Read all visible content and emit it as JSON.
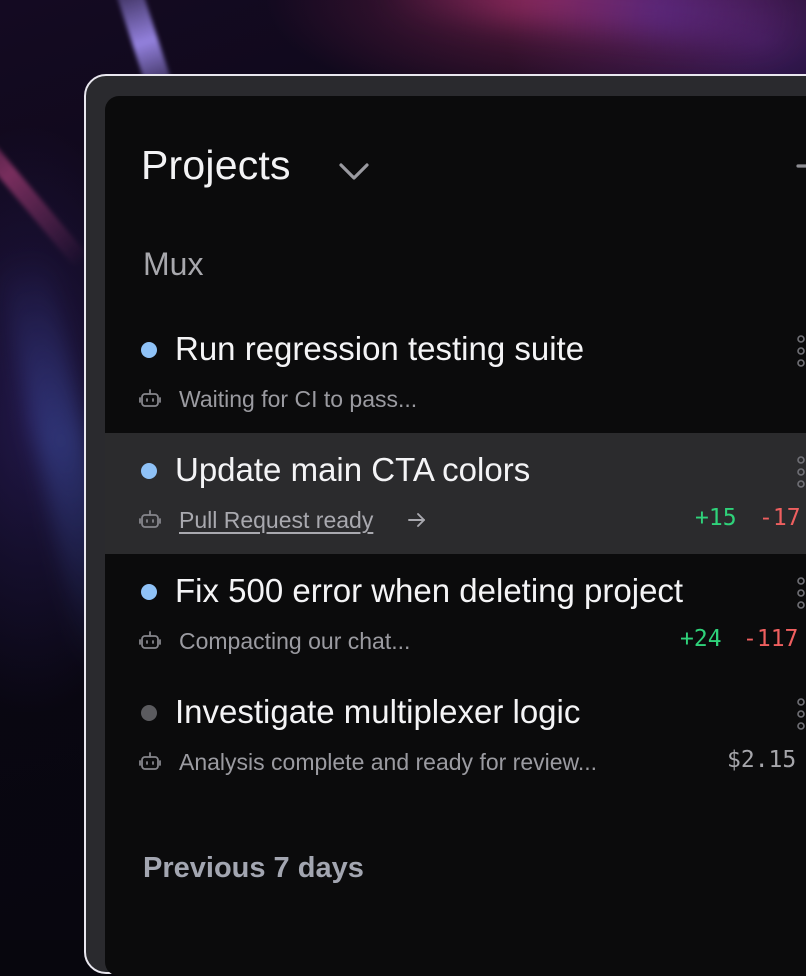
{
  "header": {
    "title": "Projects",
    "dropdown_icon": "chevron-down-icon",
    "add_icon": "plus-icon"
  },
  "group": {
    "name": "Mux"
  },
  "tasks": [
    {
      "title": "Run regression testing suite",
      "status": "Waiting for CI to pass...",
      "dot_color": "#8fc2f7",
      "active": true
    },
    {
      "title": "Update main CTA colors",
      "status": "Pull Request ready",
      "status_is_link": true,
      "additions": "+15",
      "deletions": "-17",
      "dot_color": "#8fc2f7",
      "selected": true
    },
    {
      "title": "Fix 500 error when deleting project",
      "status": "Compacting our chat...",
      "additions": "+24",
      "deletions": "-117",
      "dot_color": "#8fc2f7"
    },
    {
      "title": "Investigate multiplexer logic",
      "status": "Analysis complete and ready for review...",
      "cost": "$2.15",
      "dot_color": "#5b5b5f"
    }
  ],
  "sections": {
    "previous": "Previous 7 days"
  },
  "colors": {
    "panel_bg": "#0b0b0c",
    "selected_row": "#2b2b2d",
    "additions": "#2fd27a",
    "deletions": "#ef5f5f",
    "active_dot": "#8fc2f7",
    "idle_dot": "#5b5b5f"
  }
}
